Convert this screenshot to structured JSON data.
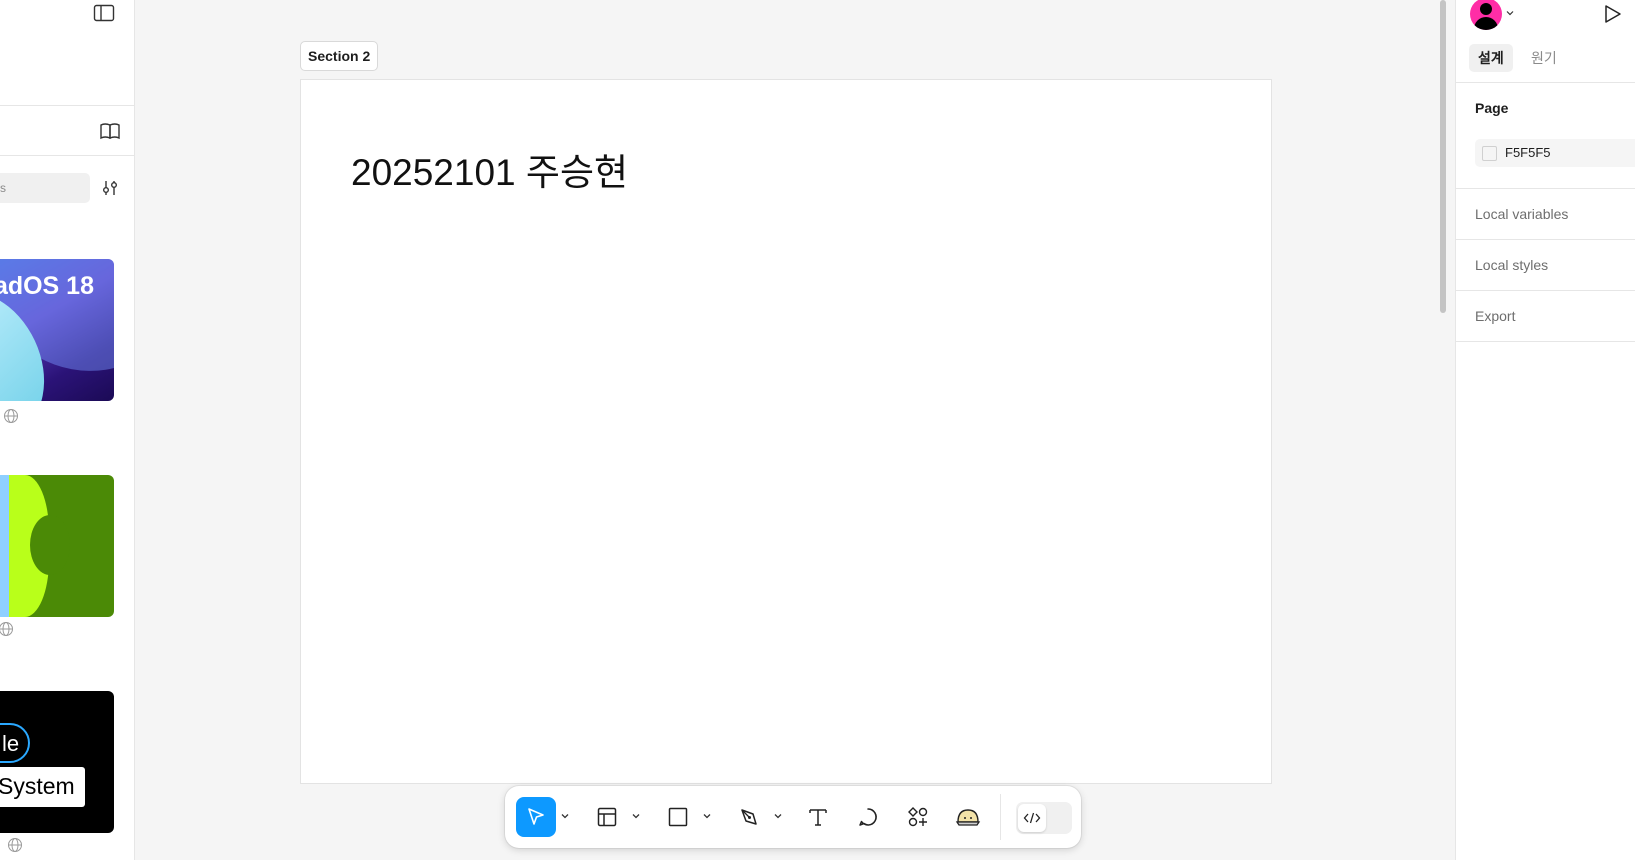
{
  "left_panel": {
    "search": {
      "placeholder_fragment": "s"
    },
    "cards": [
      {
        "title": "adOS 18"
      },
      {
        "title": ""
      },
      {
        "pill_text": "le",
        "label_text": "System"
      }
    ]
  },
  "canvas": {
    "section_label": "Section 2",
    "frame_text": "20252101 주승현"
  },
  "toolbar": {
    "tools": [
      "move",
      "frame",
      "rectangle",
      "pen",
      "text",
      "comment",
      "actions",
      "ai",
      "dev-mode"
    ]
  },
  "right_panel": {
    "tabs": [
      "설계",
      "원기"
    ],
    "page_heading": "Page",
    "page_color": "F5F5F5",
    "sections": [
      "Local variables",
      "Local styles",
      "Export"
    ]
  },
  "colors": {
    "accent": "#0d99ff",
    "canvas_bg": "#f5f5f5",
    "avatar": "#ff2da6"
  }
}
